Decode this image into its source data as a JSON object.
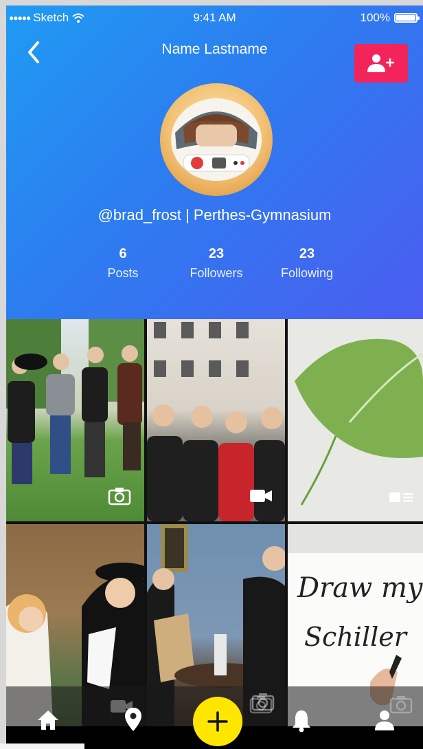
{
  "status_bar": {
    "carrier": "Sketch",
    "time": "9:41 AM",
    "battery": "100%"
  },
  "profile": {
    "name": "Name Lastname",
    "handle": "@brad_frost | Perthes-Gymnasium",
    "stats": [
      {
        "value": "6",
        "label": "Posts"
      },
      {
        "value": "23",
        "label": "Followers"
      },
      {
        "value": "23",
        "label": "Following"
      }
    ]
  },
  "colors": {
    "header_start": "#1f9bf2",
    "header_end": "#4b5df0",
    "add_button": "#f2245a",
    "fab": "#ffe600"
  },
  "grid": [
    {
      "type": "photo",
      "icon": "camera-icon"
    },
    {
      "type": "video",
      "icon": "video-icon"
    },
    {
      "type": "article",
      "icon": "article-icon"
    },
    {
      "type": "photo"
    },
    {
      "type": "photo",
      "icon": "camera-icon"
    },
    {
      "type": "photo",
      "text_lines": [
        "Draw my life",
        "Schiller"
      ]
    }
  ],
  "tabbar": {
    "items": [
      "home-icon",
      "location-pin-icon",
      "add-icon",
      "bell-icon",
      "profile-icon"
    ]
  }
}
